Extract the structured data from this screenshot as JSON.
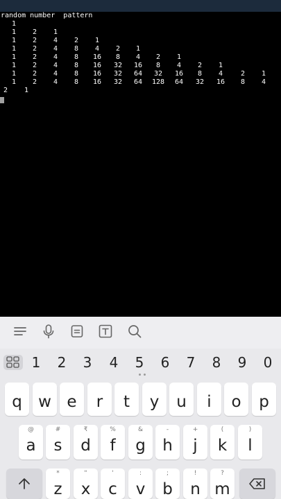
{
  "terminal": {
    "heading": "random number  pattern",
    "rows": [
      [
        "1"
      ],
      [
        "1",
        "2",
        "1"
      ],
      [
        "1",
        "2",
        "4",
        "2",
        "1"
      ],
      [
        "1",
        "2",
        "4",
        "8",
        "4",
        "2",
        "1"
      ],
      [
        "1",
        "2",
        "4",
        "8",
        "16",
        "8",
        "4",
        "2",
        "1"
      ],
      [
        "1",
        "2",
        "4",
        "8",
        "16",
        "32",
        "16",
        "8",
        "4",
        "2",
        "1"
      ],
      [
        "1",
        "2",
        "4",
        "8",
        "16",
        "32",
        "64",
        "32",
        "16",
        "8",
        "4",
        "2",
        "1"
      ],
      [
        "1",
        "2",
        "4",
        "8",
        "16",
        "32",
        "64",
        "128",
        "64",
        "32",
        "16",
        "8",
        "4"
      ]
    ],
    "wrap": [
      "2",
      "1"
    ]
  },
  "keyboard": {
    "toolbar": [
      "menu-icon",
      "microphone-icon",
      "clipboard-icon",
      "text-edit-icon",
      "search-icon"
    ],
    "numbers": [
      "1",
      "2",
      "3",
      "4",
      "5",
      "6",
      "7",
      "8",
      "9",
      "0"
    ],
    "row1": [
      "q",
      "w",
      "e",
      "r",
      "t",
      "y",
      "u",
      "i",
      "o",
      "p"
    ],
    "row2": [
      {
        "key": "a",
        "hint": "@"
      },
      {
        "key": "s",
        "hint": "#"
      },
      {
        "key": "d",
        "hint": "₹"
      },
      {
        "key": "f",
        "hint": "%"
      },
      {
        "key": "g",
        "hint": "&"
      },
      {
        "key": "h",
        "hint": "-"
      },
      {
        "key": "j",
        "hint": "+"
      },
      {
        "key": "k",
        "hint": "("
      },
      {
        "key": "l",
        "hint": ")"
      }
    ],
    "row3": [
      {
        "key": "z",
        "hint": "*"
      },
      {
        "key": "x",
        "hint": "\""
      },
      {
        "key": "c",
        "hint": "'"
      },
      {
        "key": "v",
        "hint": ":"
      },
      {
        "key": "b",
        "hint": ";"
      },
      {
        "key": "n",
        "hint": "!"
      },
      {
        "key": "m",
        "hint": "?"
      }
    ],
    "colors": {
      "key": "#ffffff",
      "function_key": "#d7d7dc",
      "background": "#e9e9ec"
    }
  }
}
